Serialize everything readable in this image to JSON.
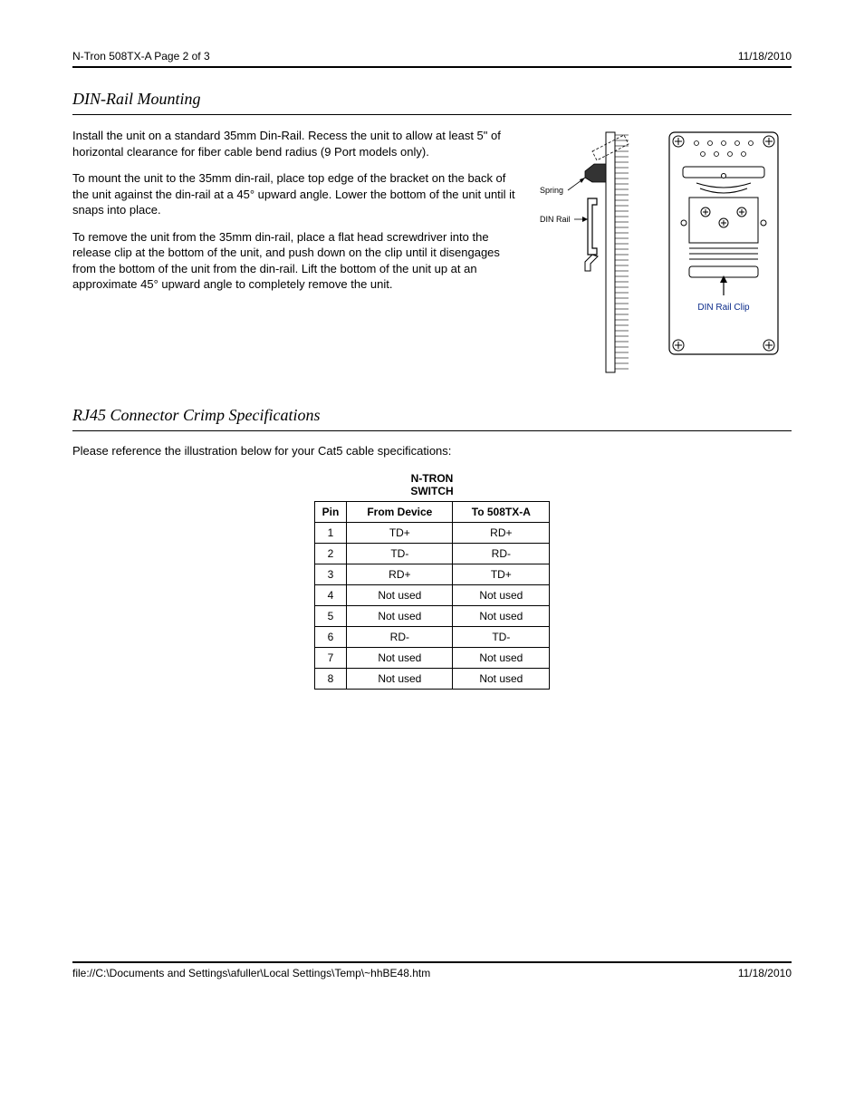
{
  "header": {
    "left": "N-Tron 508TX-A Page 2 of 3",
    "right": "11/18/2010"
  },
  "section1": {
    "title": "DIN-Rail Mounting",
    "para1": "Install the unit on a standard 35mm Din-Rail. Recess the unit to allow at least 5\" of horizontal clearance for fiber cable bend radius (9 Port models only).",
    "para2": "To mount the unit to the 35mm din-rail, place top edge of the bracket on the back of the unit against the din-rail at a 45° upward angle. Lower the bottom of the unit until it snaps into place.",
    "para3": "To remove the unit from the 35mm din-rail, place a flat head screwdriver into the release clip at the bottom of the unit, and push down on the clip until it disengages from the bottom of the unit from the din-rail. Lift the bottom of the unit up at an approximate 45° upward angle to completely remove the unit."
  },
  "section2": {
    "title": "RJ45 Connector Crimp Specifications",
    "intro": "Please reference the illustration below for your Cat5 cable specifications:",
    "table_title_line1": "N-TRON",
    "table_title_line2": "SWITCH",
    "headers": [
      "Pin",
      "From Device",
      "To 508TX-A"
    ],
    "rows": [
      [
        "1",
        "TD+",
        "RD+"
      ],
      [
        "2",
        "TD-",
        "RD-"
      ],
      [
        "3",
        "RD+",
        "TD+"
      ],
      [
        "4",
        "Not used",
        "Not used"
      ],
      [
        "5",
        "Not used",
        "Not used"
      ],
      [
        "6",
        "RD-",
        "TD-"
      ],
      [
        "7",
        "Not used",
        "Not used"
      ],
      [
        "8",
        "Not used",
        "Not used"
      ]
    ]
  },
  "figure": {
    "spring_label": "Spring",
    "din_rail_label": "DIN Rail",
    "din_rail_clip_label": "DIN Rail Clip"
  },
  "footer": {
    "left": "file://C:\\Documents and Settings\\afuller\\Local Settings\\Temp\\~hhBE48.htm",
    "right": "11/18/2010"
  }
}
